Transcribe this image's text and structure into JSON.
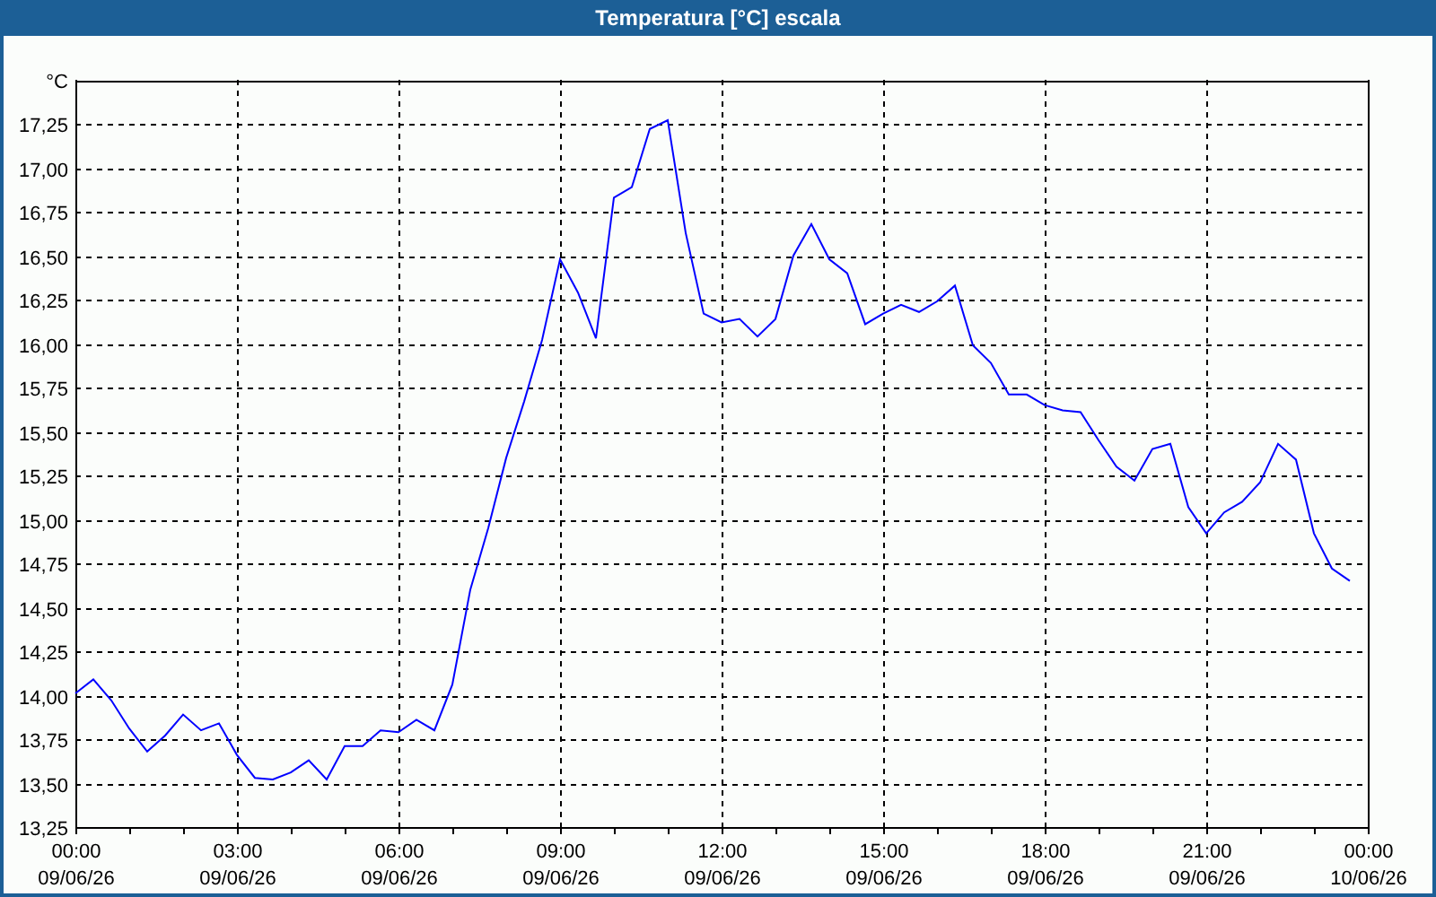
{
  "window": {
    "title": "Temperatura [°C] escala"
  },
  "chart": {
    "chart_data": {
      "type": "line",
      "grid": true,
      "ylabel": "°C",
      "ylim": [
        13.25,
        17.5
      ],
      "categories": [
        "00:00\n09/06/26",
        null,
        null,
        null,
        null,
        null,
        null,
        null,
        null,
        "03:00\n09/06/26",
        null,
        null,
        null,
        null,
        null,
        null,
        null,
        null,
        "06:00\n09/06/26",
        null,
        null,
        null,
        null,
        null,
        null,
        null,
        null,
        "09:00\n09/06/26",
        null,
        null,
        null,
        null,
        null,
        null,
        null,
        null,
        "12:00\n09/06/26",
        null,
        null,
        null,
        null,
        null,
        null,
        null,
        null,
        "15:00\n09/06/26",
        null,
        null,
        null,
        null,
        null,
        null,
        null,
        null,
        "18:00\n09/06/26",
        null,
        null,
        null,
        null,
        null,
        null,
        null,
        null,
        "21:00\n09/06/26",
        null,
        null,
        null,
        null,
        null,
        null,
        null,
        null,
        "00:00\n10/06/26"
      ],
      "yticks": [
        {
          "value": 13.25,
          "label": "13,25"
        },
        {
          "value": 13.5,
          "label": "13,50"
        },
        {
          "value": 13.75,
          "label": "13,75"
        },
        {
          "value": 14,
          "label": "14,00"
        },
        {
          "value": 14.25,
          "label": "14,25"
        },
        {
          "value": 14.5,
          "label": "14,50"
        },
        {
          "value": 14.75,
          "label": "14,75"
        },
        {
          "value": 15,
          "label": "15,00"
        },
        {
          "value": 15.25,
          "label": "15,25"
        },
        {
          "value": 15.5,
          "label": "15,50"
        },
        {
          "value": 15.75,
          "label": "15,75"
        },
        {
          "value": 16,
          "label": "16,00"
        },
        {
          "value": 16.25,
          "label": "16,25"
        },
        {
          "value": 16.5,
          "label": "16,50"
        },
        {
          "value": 16.75,
          "label": "16,75"
        },
        {
          "value": 17,
          "label": "17,00"
        },
        {
          "value": 17.25,
          "label": "17,25"
        }
      ],
      "series": [
        {
          "color": "#0000ff",
          "values": [
            14.01,
            14.09,
            13.97,
            13.81,
            13.68,
            13.77,
            13.89,
            13.8,
            13.84,
            13.66,
            13.53,
            13.52,
            13.56,
            13.63,
            13.52,
            13.71,
            13.71,
            13.8,
            13.79,
            13.86,
            13.8,
            14.06,
            14.6,
            14.95,
            15.35,
            15.67,
            16.02,
            16.48,
            16.29,
            16.03,
            16.83,
            16.89,
            17.22,
            17.27,
            16.63,
            16.17,
            16.12,
            16.14,
            16.04,
            16.14,
            16.5,
            16.68,
            16.48,
            16.4,
            16.11,
            16.17,
            16.22,
            16.18,
            16.24,
            16.33,
            15.99,
            15.89,
            15.71,
            15.71,
            15.65,
            15.62,
            15.61,
            15.45,
            15.3,
            15.22,
            15.4,
            15.43,
            15.07,
            14.92,
            15.04,
            15.1,
            15.21,
            15.43,
            15.34,
            14.92,
            14.72,
            14.65,
            null
          ]
        }
      ]
    }
  }
}
